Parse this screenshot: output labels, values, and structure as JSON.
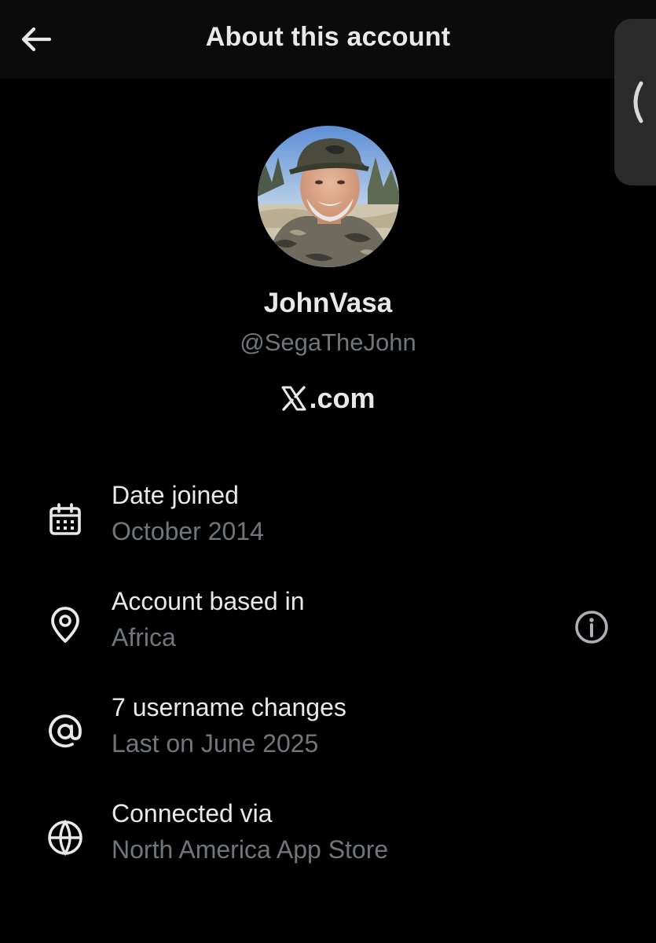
{
  "header": {
    "title": "About this account",
    "back_icon": "arrow-left-icon"
  },
  "side_handle": {
    "icon": "chevron-left-icon"
  },
  "profile": {
    "display_name": "JohnVasa",
    "handle": "@SegaTheJohn",
    "site": ".com",
    "site_logo": "x-logo-icon"
  },
  "info": [
    {
      "icon": "calendar-icon",
      "label": "Date joined",
      "value": "October 2014"
    },
    {
      "icon": "location-pin-icon",
      "label": "Account based in",
      "value": "Africa",
      "action_icon": "info-icon"
    },
    {
      "icon": "at-sign-icon",
      "label": "7 username changes",
      "value": "Last on June 2025"
    },
    {
      "icon": "globe-icon",
      "label": "Connected via",
      "value": "North America App Store"
    }
  ],
  "colors": {
    "background": "#000000",
    "header_background": "#0b0b0b",
    "primary_text": "#e7e9ea",
    "secondary_text": "#71767b",
    "side_handle": "#2b2b2b"
  }
}
